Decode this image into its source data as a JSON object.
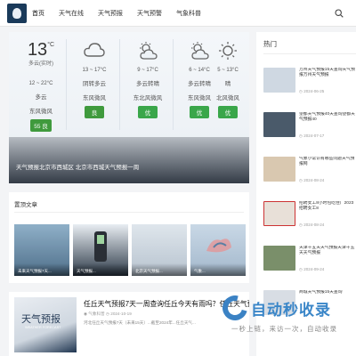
{
  "nav": {
    "items": [
      "首页",
      "天气在线",
      "天气预报",
      "天气预警",
      "气象科普"
    ]
  },
  "weather": {
    "today": {
      "temp": "13",
      "unit": "°C",
      "label": "多云(实时)",
      "range": "12 ~ 22°C",
      "cond": "多云",
      "wind": "东风微风",
      "aqi": "55 良",
      "aqi_color": "#3f9a3d"
    },
    "days": [
      {
        "icon": "cloud-icon",
        "range": "13 ~ 17°C",
        "cond": "阴转多云",
        "wind": "东风微风",
        "aqi": "良",
        "aqi_color": "#3f9a3d"
      },
      {
        "icon": "partly-cloudy-icon",
        "range": "9 ~ 17°C",
        "cond": "多云转晴",
        "wind": "东北风微风",
        "aqi": "优",
        "aqi_color": "#3aa64a"
      },
      {
        "icon": "partly-cloudy-icon",
        "range": "6 ~ 14°C",
        "cond": "多云转晴",
        "wind": "东风微风",
        "aqi": "优",
        "aqi_color": "#3aa64a"
      },
      {
        "icon": "sun-icon",
        "range": "5 ~ 13°C",
        "cond": "晴",
        "wind": "北风微风",
        "aqi": "优",
        "aqi_color": "#3aa64a"
      }
    ],
    "caption": "天气预报北京市西城区 北京市西城天气预报一周"
  },
  "hot": {
    "title": "热门",
    "items": [
      {
        "text": "万州天气预报15天查询天气预报万州天气预报",
        "date": "2024-06-25",
        "thumb": "#cfd8e2"
      },
      {
        "text": "望都天气预报40天查询望都天气预报40",
        "date": "2024-07-17",
        "thumb": "#4a5a6a"
      },
      {
        "text": "气象小常识有哪些问题天气预报网",
        "date": "2024-08-24",
        "thumb": "#d9c8b0"
      },
      {
        "text": "招聘女工8小时包吃住厂2023 招聘女工8",
        "date": "2024-08-24",
        "thumb": "#e8e0d8"
      },
      {
        "text": "天津十五天天气预报天津十五天天气预报",
        "date": "2024-09-24",
        "thumb": "#7a8f6a"
      },
      {
        "text": "商城天气预报15天查询",
        "date": "",
        "thumb": "#d8dde4"
      }
    ]
  },
  "recommend": {
    "title": "置顶文章",
    "items": [
      {
        "caption": "未来天气预报7天...",
        "color": "#6f8fa8"
      },
      {
        "caption": "天气预报...",
        "color": "#2d3a48"
      },
      {
        "caption": "北京天气预报...",
        "color": "#c9d3dc"
      },
      {
        "caption": "气象...",
        "color": "#b8c7d6"
      }
    ]
  },
  "article": {
    "img_title": "天气预报",
    "img_sub": "WEATHER FORECAST",
    "title": "任丘天气预报7天一周查询任丘今天有雨吗？任丘天气预报7天",
    "author": "气象科普",
    "date": "2024-10-19",
    "summary": "河北任丘天气预报7天（未来15天）...截至2024年...任丘天气..."
  },
  "watermark": {
    "brand": "自动秒收录",
    "slogan": "一秒上链，来访一次，自动收录"
  }
}
